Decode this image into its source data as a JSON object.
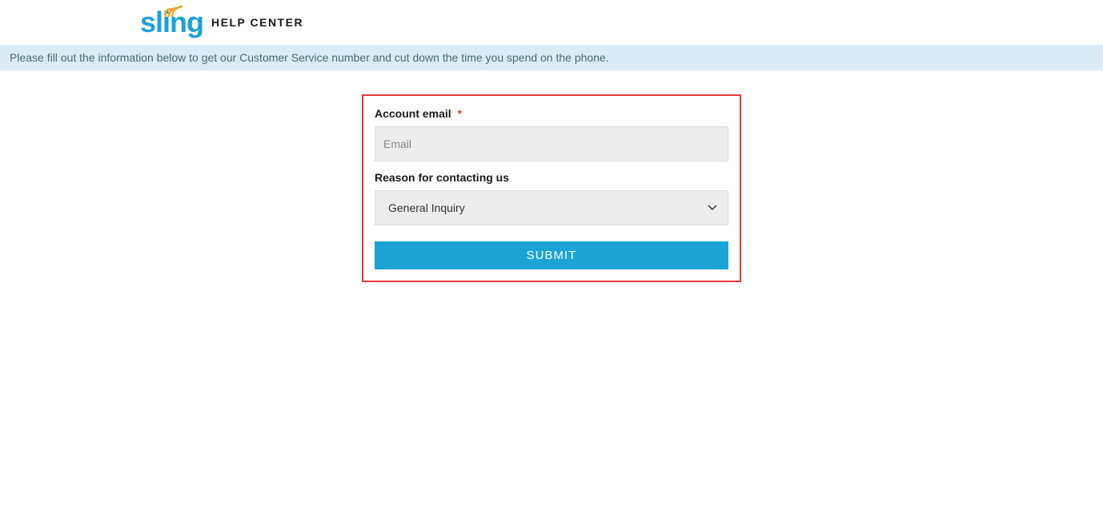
{
  "header": {
    "logo_text": "sling",
    "help_center_label": "HELP CENTER"
  },
  "banner": {
    "message": "Please fill out the information below to get our Customer Service number and cut down the time you spend on the phone."
  },
  "form": {
    "email_label": "Account email",
    "email_placeholder": "Email",
    "email_value": "",
    "reason_label": "Reason for contacting us",
    "reason_selected": "General Inquiry",
    "submit_label": "SUBMIT"
  }
}
